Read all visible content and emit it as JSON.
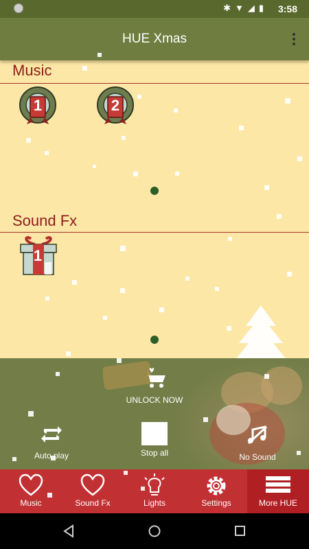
{
  "status": {
    "time": "3:58",
    "icons": [
      "bluetooth-icon",
      "wifi-icon",
      "signal-icon",
      "battery-icon"
    ]
  },
  "appbar": {
    "title": "HUE Xmas"
  },
  "music": {
    "title": "Music",
    "items": [
      "1",
      "2"
    ]
  },
  "soundfx": {
    "title": "Sound Fx",
    "items": [
      "1"
    ]
  },
  "controls": {
    "unlock": "UNLOCK NOW",
    "autoplay": "Auto play",
    "stopall": "Stop all",
    "nosound": "No Sound"
  },
  "tabs": [
    "Music",
    "Sound Fx",
    "Lights",
    "Settings",
    "More HUE"
  ],
  "colors": {
    "statusbar": "#59692d",
    "appbar": "#6f7d40",
    "background": "#fde7a6",
    "tabbar": "#c13033",
    "accent": "#8e1d1d"
  }
}
